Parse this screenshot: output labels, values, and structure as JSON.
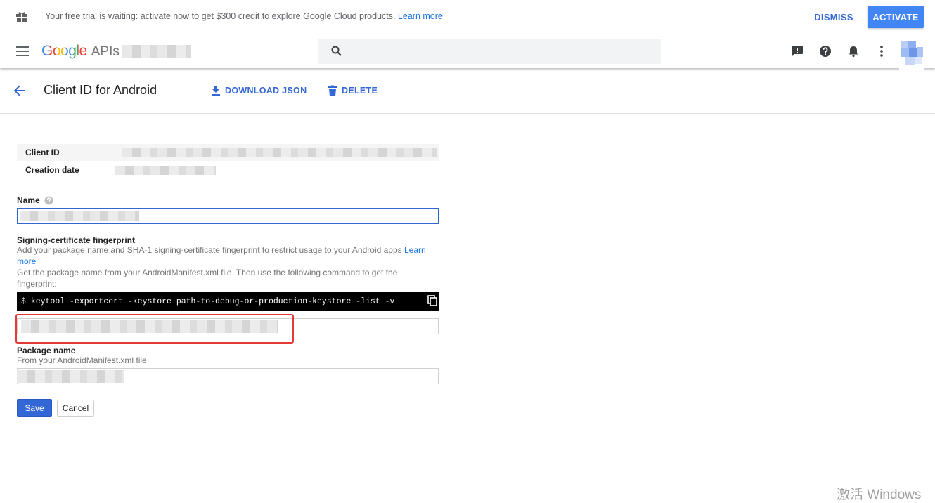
{
  "banner": {
    "text": "Your free trial is waiting: activate now to get $300 credit to explore Google Cloud products.",
    "link": "Learn more",
    "dismiss": "DISMISS",
    "activate": "ACTIVATE"
  },
  "appbar": {
    "logo_google": "Google",
    "logo_apis": "APIs",
    "search_placeholder": ""
  },
  "subheader": {
    "title": "Client ID for Android",
    "download": "DOWNLOAD JSON",
    "delete": "DELETE"
  },
  "info": {
    "client_id_label": "Client ID",
    "creation_date_label": "Creation date"
  },
  "form": {
    "name_label": "Name",
    "cert_label": "Signing-certificate fingerprint",
    "cert_help_1": "Add your package name and SHA-1 signing-certificate fingerprint to restrict usage to your Android apps",
    "cert_help_link": "Learn more",
    "cert_help_2": "Get the package name from your AndroidManifest.xml file. Then use the following command to get the fingerprint:",
    "command_prompt": "$",
    "command": "keytool -exportcert -keystore path-to-debug-or-production-keystore -list -v",
    "package_label": "Package name",
    "package_help": "From your AndroidManifest.xml file",
    "save": "Save",
    "cancel": "Cancel"
  },
  "watermark": "激活 Windows",
  "colors": {
    "accent": "#3367d6",
    "activate_bg": "#4285f4",
    "highlight": "#e53935"
  }
}
